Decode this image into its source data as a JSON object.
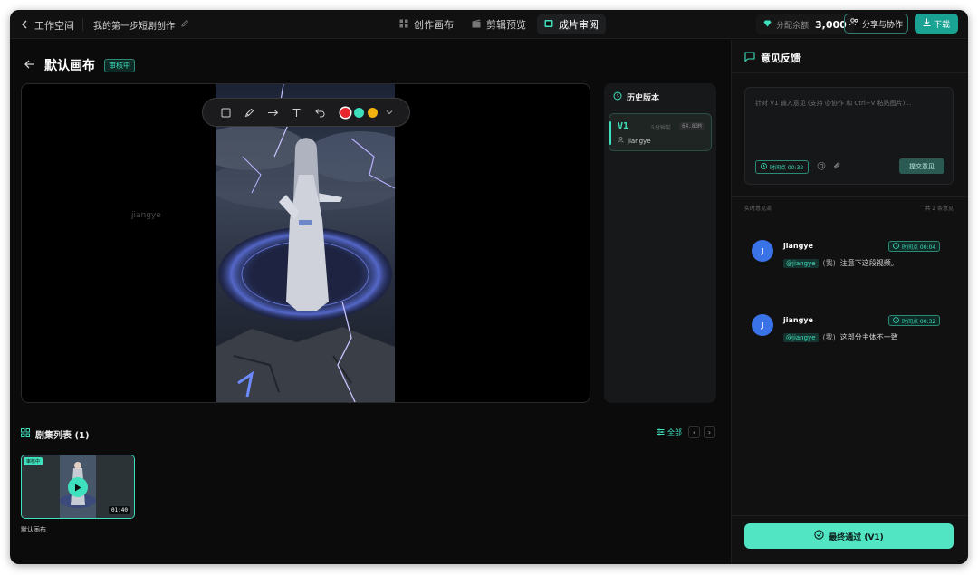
{
  "topbar": {
    "back_label": "工作空间",
    "project_name": "我的第一步短剧创作",
    "tabs": [
      {
        "label": "创作画布",
        "icon": "grid-icon"
      },
      {
        "label": "剪辑预览",
        "icon": "clapper-icon"
      },
      {
        "label": "成片审阅",
        "icon": "film-icon",
        "active": true
      }
    ],
    "balance_label": "分配余额",
    "balance_value": "3,000",
    "share_label": "分享与协作",
    "download_label": "下载"
  },
  "canvas": {
    "title": "默认画布",
    "status": "审核中",
    "watermark": "jiangye",
    "colors": [
      "#e8262e",
      "#3fe0bd",
      "#f2b20f"
    ]
  },
  "history": {
    "title": "历史版本",
    "versions": [
      {
        "version": "V1",
        "ago": "5分钟前",
        "size": "64.83M",
        "author": "jiangye"
      }
    ]
  },
  "episodes": {
    "title": "剧集列表 (1)",
    "all_label": "全部",
    "items": [
      {
        "label": "默认画布",
        "badge": "审核中",
        "duration": "01:40"
      }
    ]
  },
  "feedback": {
    "title": "意见反馈",
    "placeholder": "针对 V1 输入意见 (支持 @协作 和 Ctrl+V 粘贴图片)...",
    "timestamp_chip": "时间点 00:32",
    "submit_label": "提交意见",
    "stream_label": "实时意见流",
    "count_label": "共 2 条意见",
    "comments": [
      {
        "avatar": "J",
        "name": "jiangye",
        "time": "时间点 00:04",
        "mention": "@jiangye",
        "self": "(我)",
        "text": "注意下这段视频。"
      },
      {
        "avatar": "J",
        "name": "jiangye",
        "time": "时间点 00:32",
        "mention": "@jiangye",
        "self": "(我)",
        "text": "这部分主体不一致"
      }
    ],
    "final_label": "最终通过 (V1)"
  }
}
